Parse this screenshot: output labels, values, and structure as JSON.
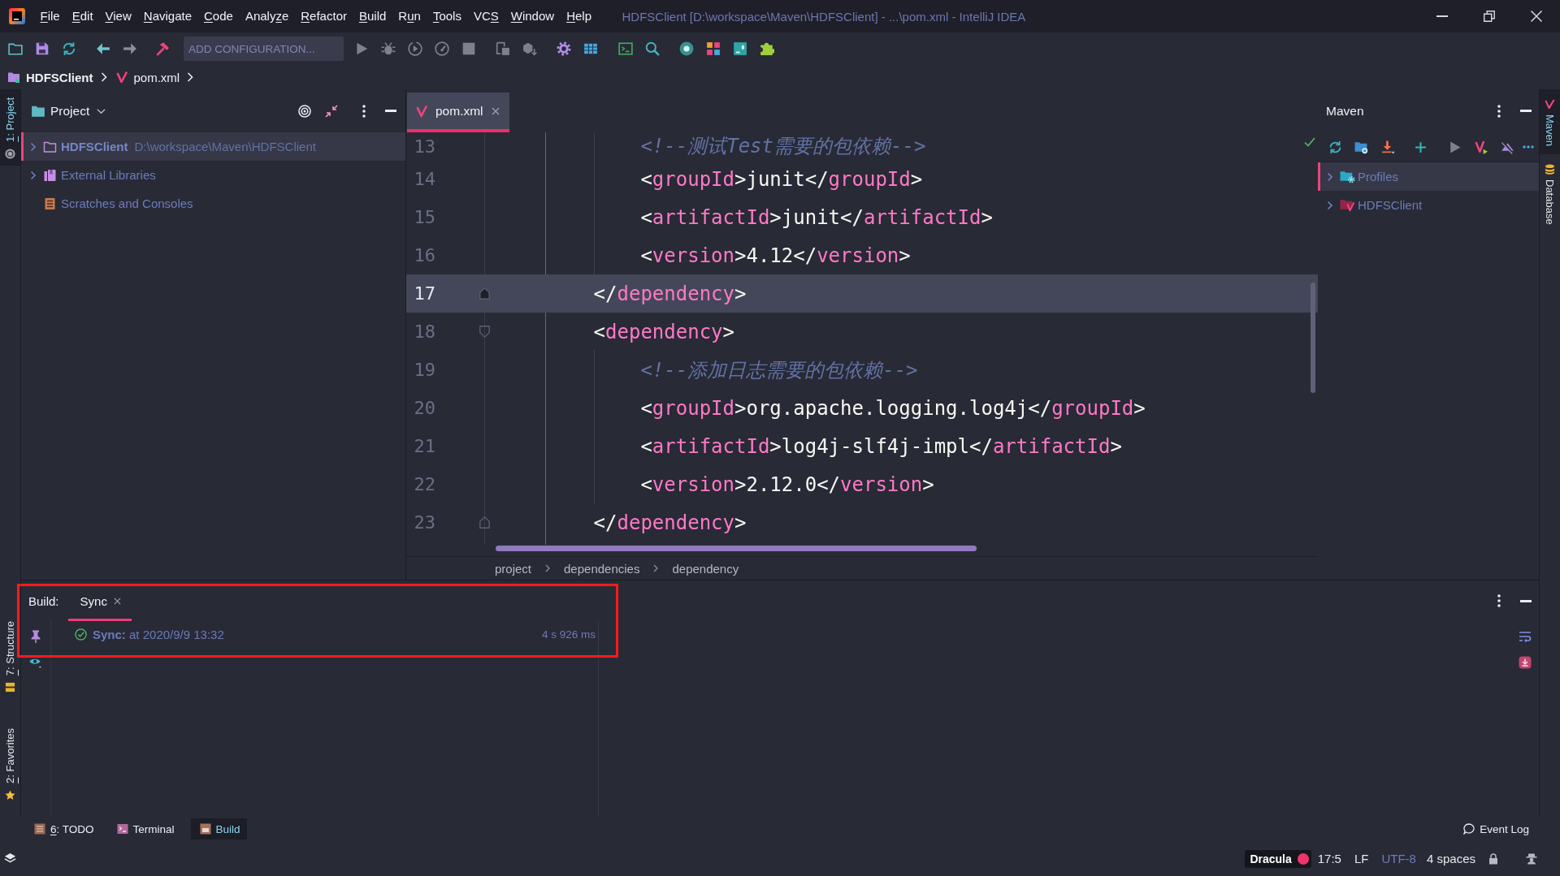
{
  "window": {
    "title": "HDFSClient [D:\\workspace\\Maven\\HDFSClient] - ...\\pom.xml - IntelliJ IDEA"
  },
  "menu": [
    {
      "key": "F",
      "rest": "ile"
    },
    {
      "key": "E",
      "rest": "dit"
    },
    {
      "key": "V",
      "rest": "iew"
    },
    {
      "key": "N",
      "rest": "avigate"
    },
    {
      "key": "C",
      "rest": "ode"
    },
    {
      "pre": "Analy",
      "key": "z",
      "rest": "e"
    },
    {
      "key": "R",
      "rest": "efactor"
    },
    {
      "key": "B",
      "rest": "uild"
    },
    {
      "pre": "R",
      "key": "u",
      "rest": "n"
    },
    {
      "key": "T",
      "rest": "ools"
    },
    {
      "pre": "VC",
      "key": "S"
    },
    {
      "key": "W",
      "rest": "indow"
    },
    {
      "key": "H",
      "rest": "elp"
    }
  ],
  "toolbar": {
    "run_configuration": "ADD CONFIGURATION..."
  },
  "navigation_bar": [
    {
      "label": "HDFSClient",
      "kind": "module"
    },
    {
      "label": "pom.xml",
      "kind": "maven"
    }
  ],
  "left_strip": {
    "top": [
      {
        "key": "1",
        "rest": ": Project",
        "kind": "project",
        "selected": true
      }
    ],
    "bottom": [
      {
        "key": "7",
        "rest": ": Structure",
        "kind": "structure",
        "selected": false
      },
      {
        "key": "2",
        "rest": ": Favorites",
        "kind": "favorites",
        "selected": false
      }
    ]
  },
  "project_panel": {
    "title": "Project",
    "items": [
      {
        "label": "HDFSClient",
        "detail": "D:\\workspace\\Maven\\HDFSClient",
        "kind": "module",
        "selected": true,
        "expanded": false
      },
      {
        "label": "External Libraries",
        "kind": "libraries",
        "selected": false,
        "expanded": false
      },
      {
        "label": "Scratches and Consoles",
        "kind": "scratches",
        "selected": false
      }
    ]
  },
  "editor": {
    "tabs": [
      {
        "label": "pom.xml",
        "selected": true
      }
    ],
    "lines": [
      {
        "number": "13",
        "current": false,
        "fold_start": false,
        "fold_end": false,
        "segments": [
          {
            "kind": "comment",
            "text": "            <!--测试Test需要的包依赖-->"
          }
        ]
      },
      {
        "number": "14",
        "current": false,
        "fold_start": false,
        "fold_end": false,
        "segments": [
          {
            "kind": "punct",
            "text": "            <"
          },
          {
            "kind": "tag",
            "text": "groupId"
          },
          {
            "kind": "punct",
            "text": ">"
          },
          {
            "kind": "text",
            "text": "junit"
          },
          {
            "kind": "punct",
            "text": "</"
          },
          {
            "kind": "tag",
            "text": "groupId"
          },
          {
            "kind": "punct",
            "text": ">"
          }
        ]
      },
      {
        "number": "15",
        "current": false,
        "fold_start": false,
        "fold_end": false,
        "segments": [
          {
            "kind": "punct",
            "text": "            <"
          },
          {
            "kind": "tag",
            "text": "artifactId"
          },
          {
            "kind": "punct",
            "text": ">"
          },
          {
            "kind": "text",
            "text": "junit"
          },
          {
            "kind": "punct",
            "text": "</"
          },
          {
            "kind": "tag",
            "text": "artifactId"
          },
          {
            "kind": "punct",
            "text": ">"
          }
        ]
      },
      {
        "number": "16",
        "current": false,
        "fold_start": false,
        "fold_end": false,
        "segments": [
          {
            "kind": "punct",
            "text": "            <"
          },
          {
            "kind": "tag",
            "text": "version"
          },
          {
            "kind": "punct",
            "text": ">"
          },
          {
            "kind": "text",
            "text": "4.12"
          },
          {
            "kind": "punct",
            "text": "</"
          },
          {
            "kind": "tag",
            "text": "version"
          },
          {
            "kind": "punct",
            "text": ">"
          }
        ]
      },
      {
        "number": "17",
        "current": true,
        "fold_start": false,
        "fold_end": true,
        "segments": [
          {
            "kind": "punct",
            "text": "        </"
          },
          {
            "kind": "tag",
            "text": "dependency"
          },
          {
            "kind": "punct",
            "text": ">"
          }
        ]
      },
      {
        "number": "18",
        "current": false,
        "fold_start": true,
        "fold_end": false,
        "segments": [
          {
            "kind": "punct",
            "text": "        <"
          },
          {
            "kind": "tag",
            "text": "dependency"
          },
          {
            "kind": "punct",
            "text": ">"
          }
        ]
      },
      {
        "number": "19",
        "current": false,
        "fold_start": false,
        "fold_end": false,
        "segments": [
          {
            "kind": "comment",
            "text": "            <!--添加日志需要的包依赖-->"
          }
        ]
      },
      {
        "number": "20",
        "current": false,
        "fold_start": false,
        "fold_end": false,
        "segments": [
          {
            "kind": "punct",
            "text": "            <"
          },
          {
            "kind": "tag",
            "text": "groupId"
          },
          {
            "kind": "punct",
            "text": ">"
          },
          {
            "kind": "text",
            "text": "org.apache.logging.log4j"
          },
          {
            "kind": "punct",
            "text": "</"
          },
          {
            "kind": "tag",
            "text": "groupId"
          },
          {
            "kind": "punct",
            "text": ">"
          }
        ]
      },
      {
        "number": "21",
        "current": false,
        "fold_start": false,
        "fold_end": false,
        "segments": [
          {
            "kind": "punct",
            "text": "            <"
          },
          {
            "kind": "tag",
            "text": "artifactId"
          },
          {
            "kind": "punct",
            "text": ">"
          },
          {
            "kind": "text",
            "text": "log4j-slf4j-impl"
          },
          {
            "kind": "punct",
            "text": "</"
          },
          {
            "kind": "tag",
            "text": "artifactId"
          },
          {
            "kind": "punct",
            "text": ">"
          }
        ]
      },
      {
        "number": "22",
        "current": false,
        "fold_start": false,
        "fold_end": false,
        "segments": [
          {
            "kind": "punct",
            "text": "            <"
          },
          {
            "kind": "tag",
            "text": "version"
          },
          {
            "kind": "punct",
            "text": ">"
          },
          {
            "kind": "text",
            "text": "2.12.0"
          },
          {
            "kind": "punct",
            "text": "</"
          },
          {
            "kind": "tag",
            "text": "version"
          },
          {
            "kind": "punct",
            "text": ">"
          }
        ]
      },
      {
        "number": "23",
        "current": false,
        "fold_start": false,
        "fold_end": true,
        "segments": [
          {
            "kind": "punct",
            "text": "        </"
          },
          {
            "kind": "tag",
            "text": "dependency"
          },
          {
            "kind": "punct",
            "text": ">"
          }
        ]
      }
    ],
    "breadcrumbs": [
      "project",
      "dependencies",
      "dependency"
    ]
  },
  "maven_panel": {
    "title": "Maven",
    "items": [
      {
        "label": "Profiles",
        "kind": "profiles",
        "selected": true,
        "expanded": false
      },
      {
        "label": "HDFSClient",
        "kind": "project",
        "selected": false,
        "expanded": false
      }
    ]
  },
  "right_strip": [
    {
      "label": "Maven",
      "kind": "maven",
      "selected": true
    },
    {
      "label": "Database",
      "kind": "database",
      "selected": false
    }
  ],
  "build_panel": {
    "title": "Build:",
    "tabs": [
      {
        "label": "Sync",
        "selected": true
      }
    ],
    "entries": [
      {
        "succeeded": true,
        "text": "**Sync:** at 2020/9/9 13:32",
        "duration": "4 s 926 ms"
      }
    ]
  },
  "tool_buttons": {
    "left": [
      {
        "key": "6",
        "rest": ": TODO",
        "kind": "todo",
        "selected": false
      },
      {
        "label": "Terminal",
        "kind": "terminal",
        "selected": false
      },
      {
        "label": "Build",
        "kind": "build",
        "selected": true
      }
    ],
    "right": [
      {
        "label": "Event Log",
        "kind": "event-log"
      }
    ]
  },
  "status_bar": {
    "theme": "Dracula",
    "caret": "17:5",
    "line_separator": "LF",
    "encoding": "UTF-8",
    "indent": "4 spaces"
  }
}
